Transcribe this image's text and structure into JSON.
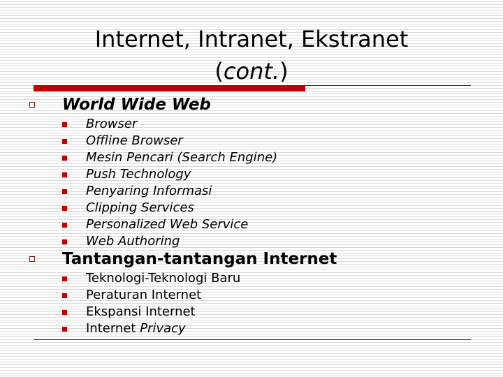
{
  "slide": {
    "title_line1": "Internet, Intranet, Ekstranet",
    "title_paren_open": "(",
    "title_cont": "cont.",
    "title_paren_close": ")"
  },
  "sections": [
    {
      "heading": "World Wide Web",
      "items": [
        "Browser",
        "Offline Browser",
        "Mesin Pencari (Search Engine)",
        "Push Technology",
        "Penyaring Informasi",
        "Clipping Services",
        "Personalized Web Service",
        "Web Authoring"
      ]
    },
    {
      "heading": "Tantangan-tantangan Internet",
      "items": [
        "Teknologi-Teknologi Baru",
        "Peraturan Internet",
        "Ekspansi Internet",
        "Internet "
      ],
      "last_item_italic_suffix": "Privacy"
    }
  ],
  "colors": {
    "accent_red": "#c00000",
    "rule_dark": "#6b1a22"
  }
}
